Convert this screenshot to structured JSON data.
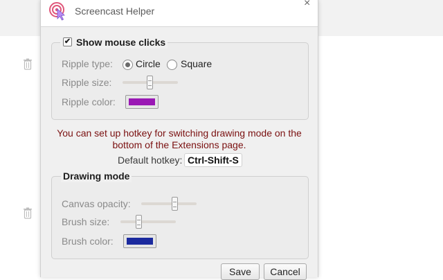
{
  "colors": {
    "ripple_color": "#9a18b4",
    "brush_color": "#1b2a9e",
    "notice_text": "#7a1010",
    "dialog_bg": "#f0f0f0"
  },
  "icons": {
    "app": "cursor-target-icon",
    "close": "close-icon",
    "background_rows": "trash-icon"
  },
  "dialog": {
    "title": "Screencast Helper",
    "close_glyph": "×"
  },
  "mouse_clicks": {
    "legend": "Show mouse clicks",
    "checked": true,
    "ripple_type_label": "Ripple type:",
    "ripple_types": [
      "Circle",
      "Square"
    ],
    "ripple_type_selected": "Circle",
    "ripple_size_label": "Ripple size:",
    "ripple_size_level": 0.5,
    "ripple_color_label": "Ripple color:"
  },
  "notice": {
    "line1": "You can set up hotkey for switching drawing mode on the",
    "line2": "bottom of the Extensions page."
  },
  "hotkey": {
    "label": "Default hotkey:",
    "value": "Ctrl-Shift-S"
  },
  "drawing_mode": {
    "legend": "Drawing mode",
    "canvas_opacity_label": "Canvas opacity:",
    "canvas_opacity_level": 0.6,
    "brush_size_label": "Brush size:",
    "brush_size_level": 0.3,
    "brush_color_label": "Brush color:"
  },
  "buttons": {
    "save": "Save",
    "cancel": "Cancel"
  }
}
